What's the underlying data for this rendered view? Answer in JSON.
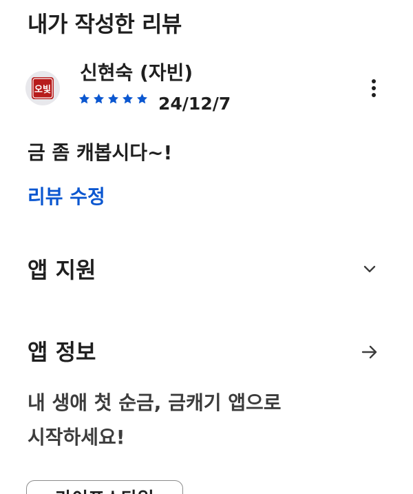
{
  "section": {
    "title": "내가 작성한 리뷰"
  },
  "review": {
    "reviewer_name": "신현숙 (자빈)",
    "avatar_text": "오빛",
    "rating": 5,
    "date": "24/12/7",
    "body": "금 좀 캐봅시다~!",
    "edit_label": "리뷰 수정",
    "more_icon": "more-vert-icon"
  },
  "app_support": {
    "title": "앱 지원",
    "icon": "chevron-down-icon"
  },
  "app_info": {
    "title": "앱 정보",
    "icon": "arrow-right-icon",
    "description_line1": "내 생애 첫 순금, 금캐기 앱으로",
    "description_line2": "시작하세요!"
  },
  "tags": {
    "first": "라이프스타일"
  },
  "colors": {
    "star": "#0b57d0",
    "link": "#0b57d0",
    "text": "#1f1f1f",
    "avatar_mark": "#c62828"
  }
}
